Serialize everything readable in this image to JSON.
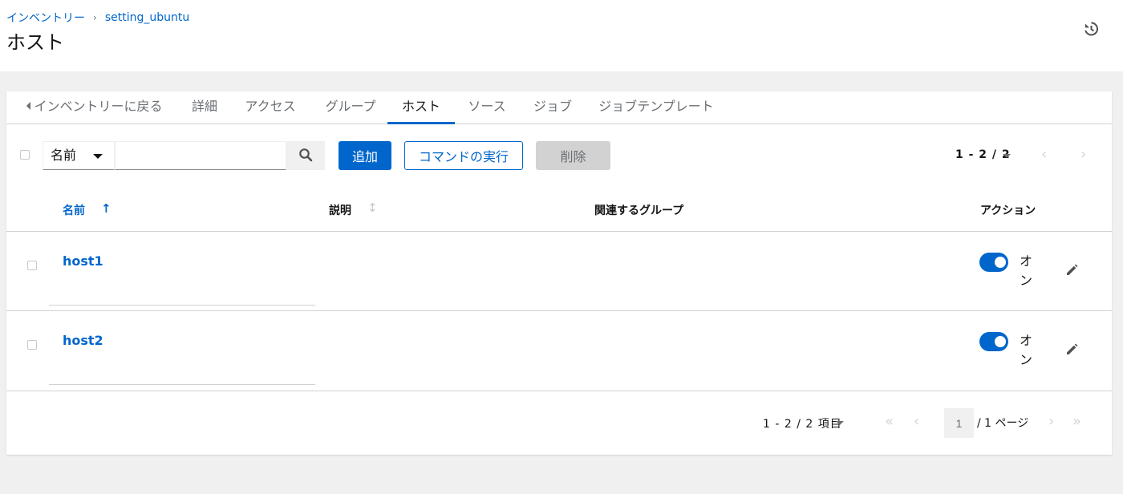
{
  "breadcrumb": {
    "inventory": "インベントリー",
    "separator": "›",
    "current": "setting_ubuntu"
  },
  "page": {
    "title": "ホスト"
  },
  "tabs": [
    {
      "label": "インベントリーに戻る",
      "active": false
    },
    {
      "label": "詳細",
      "active": false
    },
    {
      "label": "アクセス",
      "active": false
    },
    {
      "label": "グループ",
      "active": false
    },
    {
      "label": "ホスト",
      "active": true
    },
    {
      "label": "ソース",
      "active": false
    },
    {
      "label": "ジョブ",
      "active": false
    },
    {
      "label": "ジョブテンプレート",
      "active": false
    }
  ],
  "toolbar": {
    "filter_value": "名前",
    "search_value": "",
    "add_label": "追加",
    "run_command_label": "コマンドの実行",
    "delete_label": "削除",
    "pagination_text": "1 - 2 / 2"
  },
  "table": {
    "columns": {
      "name": "名前",
      "description": "説明",
      "related_groups": "関連するグループ",
      "actions": "アクション"
    },
    "rows": [
      {
        "name": "host1",
        "toggle_label": "オン",
        "enabled": true
      },
      {
        "name": "host2",
        "toggle_label": "オン",
        "enabled": true
      }
    ]
  },
  "pagination": {
    "items_text": "1 - 2 / 2 項目",
    "page_value": "1",
    "page_of_text": "/ 1 ページ"
  },
  "colors": {
    "accent": "#0066cc",
    "page_bg": "#f0f0f0",
    "border": "#d2d2d2",
    "muted": "#6a6e73"
  },
  "icons": {
    "history": "history-icon",
    "search": "search-icon",
    "edit": "pencil-icon",
    "first": "double-chevron-left-icon",
    "prev": "chevron-left-icon",
    "next": "chevron-right-icon",
    "last": "double-chevron-right-icon"
  }
}
